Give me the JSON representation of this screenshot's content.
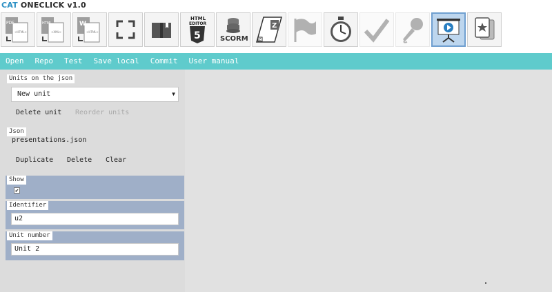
{
  "app": {
    "title_prefix": "CAT",
    "title_rest": "ONECLICK v1.0"
  },
  "toolbar": {
    "icons": [
      {
        "name": "pdf-to-html-icon",
        "label": "PDF"
      },
      {
        "name": "html-to-xml-icon",
        "label": "HTML"
      },
      {
        "name": "word-to-html-icon",
        "label": "W"
      },
      {
        "name": "fullscreen-icon"
      },
      {
        "name": "book-icon"
      },
      {
        "name": "html5-editor-icon",
        "label_top": "HTML",
        "label_mid": "EDITOR",
        "label_num": "5"
      },
      {
        "name": "scorm-icon",
        "label": "SCORM"
      },
      {
        "name": "zip-icon"
      },
      {
        "name": "flag-icon"
      },
      {
        "name": "stopwatch-icon"
      },
      {
        "name": "checkmark-icon"
      },
      {
        "name": "microphone-icon"
      },
      {
        "name": "presentation-icon",
        "active": true
      },
      {
        "name": "cards-icon"
      }
    ]
  },
  "menu": {
    "open": "Open",
    "repo": "Repo",
    "test": "Test",
    "save_local": "Save local",
    "commit": "Commit",
    "user_manual": "User manual"
  },
  "units": {
    "label": "Units on the json",
    "selected": "New unit",
    "delete_label": "Delete unit",
    "reorder_label": "Reorder units"
  },
  "json": {
    "label": "Json",
    "filename": "presentations.json",
    "duplicate_label": "Duplicate",
    "delete_label": "Delete",
    "clear_label": "Clear"
  },
  "show": {
    "label": "Show",
    "checked_glyph": "✔"
  },
  "identifier": {
    "label": "Identifier",
    "value": "u2"
  },
  "unit_number": {
    "label": "Unit number",
    "value": "Unit 2"
  },
  "colors": {
    "accent_menu": "#5fcbcc",
    "title_accent": "#2a8fc4",
    "panel_blue": "#9fafc8",
    "background": "#e1e1e1"
  }
}
